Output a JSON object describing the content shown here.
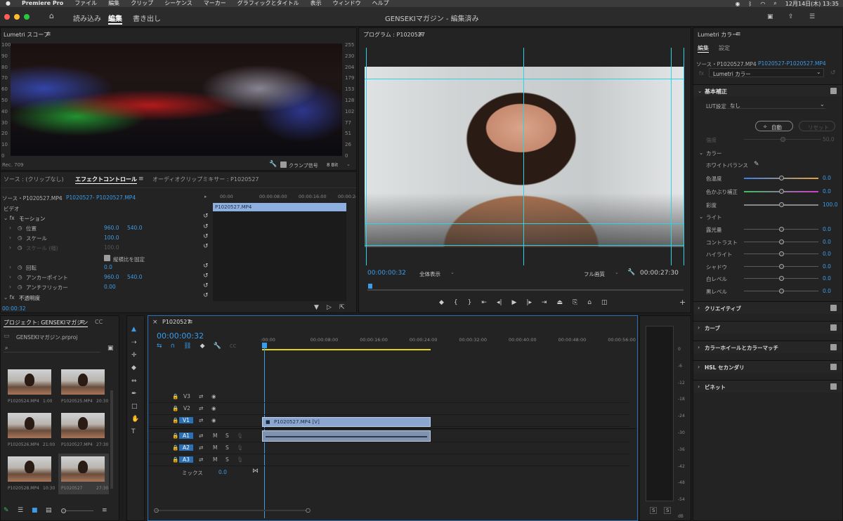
{
  "menubar": {
    "apple": "",
    "app": "Premiere Pro",
    "items": [
      "ファイル",
      "編集",
      "クリップ",
      "シーケンス",
      "マーカー",
      "グラフィックとタイトル",
      "表示",
      "ウィンドウ",
      "ヘルプ"
    ],
    "datetime": "12月14日(木) 13:35"
  },
  "titlebar": {
    "title": "GENSEKIマガジン - 編集済み",
    "tabs": [
      "読み込み",
      "編集",
      "書き出し"
    ]
  },
  "lumetri_scope": {
    "tab": "Lumetri スコープ",
    "left_ticks": [
      "100",
      "90",
      "80",
      "70",
      "60",
      "50",
      "40",
      "30",
      "20",
      "10",
      "0"
    ],
    "right_ticks": [
      "255",
      "230",
      "204",
      "179",
      "153",
      "128",
      "102",
      "77",
      "51",
      "26",
      "0"
    ],
    "footer_left": "Rec. 709",
    "clamp_label": "クランプ信号",
    "bit_depth": "8 Bit"
  },
  "effects": {
    "tabs": [
      "ソース : (クリップなし)",
      "エフェクトコントロール",
      "オーディオクリップミキサー : P1020527"
    ],
    "source_label": "ソース・P1020527.MP4",
    "sequence_label": "P1020527- P1020527.MP4",
    "time_ticks": [
      "00:00",
      "00:00:08:00",
      "00:00:16:00",
      "00:00:24:00"
    ],
    "clip_label": "P1020527.MP4",
    "video_label": "ビデオ",
    "motion": "モーション",
    "rows": [
      {
        "name": "位置",
        "v1": "960.0",
        "v2": "540.0"
      },
      {
        "name": "スケール",
        "v1": "100.0",
        "v2": ""
      },
      {
        "name": "スケール (幅)",
        "v1": "100.0",
        "v2": ""
      },
      {
        "name": "回転",
        "v1": "0.0",
        "v2": ""
      },
      {
        "name": "アンカーポイント",
        "v1": "960.0",
        "v2": "540.0"
      },
      {
        "name": "アンチフリッカー",
        "v1": "0.00",
        "v2": ""
      }
    ],
    "aspect_lock": "縦横比を固定",
    "opacity": "不透明度",
    "timecode": "00:00:32"
  },
  "program": {
    "tab": "プログラム : P1020527",
    "timecode_left": "00:00:00:32",
    "fit": "全体表示",
    "quality": "フル画質",
    "timecode_right": "00:00:27:30"
  },
  "lumetri_color": {
    "tab": "Lumetri カラー",
    "subtabs": [
      "編集",
      "設定"
    ],
    "source": "ソース・P1020527.MP4",
    "sequence": "P1020527-P1020527.MP4",
    "effect_name": "Lumetri カラー",
    "basic": "基本補正",
    "lut_label": "LUT設定",
    "lut_value": "なし",
    "auto": "自動",
    "reset": "リセット",
    "intensity": "強度",
    "intensity_val": "50.0",
    "color_group": "カラー",
    "white_balance": "ホワイトバランス",
    "light_group": "ライト",
    "sliders": [
      {
        "name": "色温度",
        "value": "0.0"
      },
      {
        "name": "色かぶり補正",
        "value": "0.0"
      },
      {
        "name": "彩度",
        "value": "100.0"
      }
    ],
    "light_sliders": [
      {
        "name": "露光量",
        "value": "0.0"
      },
      {
        "name": "コントラスト",
        "value": "0.0"
      },
      {
        "name": "ハイライト",
        "value": "0.0"
      },
      {
        "name": "シャドウ",
        "value": "0.0"
      },
      {
        "name": "白レベル",
        "value": "0.0"
      },
      {
        "name": "黒レベル",
        "value": "0.0"
      }
    ],
    "sections": [
      "クリエイティブ",
      "カーブ",
      "カラーホイールとカラーマッチ",
      "HSL セカンダリ",
      "ビネット"
    ]
  },
  "project": {
    "tabs": [
      "プロジェクト: GENSEKIマガジン",
      "CC"
    ],
    "file": "GENSEKIマガジン.prproj",
    "items": [
      {
        "name": "P1020524.MP4",
        "dur": "1:00"
      },
      {
        "name": "P1020525.MP4",
        "dur": "20:30"
      },
      {
        "name": "P1020526.MP4",
        "dur": "21:00"
      },
      {
        "name": "P1020527.MP4",
        "dur": "27:30"
      },
      {
        "name": "P1020528.MP4",
        "dur": "10:30"
      },
      {
        "name": "P1020527",
        "dur": "27:30"
      }
    ]
  },
  "timeline": {
    "tab": "P1020527",
    "timecode": "00:00:00:32",
    "ticks": [
      ":00:00",
      "00:00:08:00",
      "00:00:16:00",
      "00:00:24:00",
      "00:00:32:00",
      "00:00:40:00",
      "00:00:48:00",
      "00:00:56:00"
    ],
    "video_tracks": [
      "V3",
      "V2",
      "V1"
    ],
    "audio_tracks": [
      "A1",
      "A2",
      "A3"
    ],
    "mix": "ミックス",
    "mix_val": "0.0",
    "clip_v": "P1020527.MP4 [V]"
  },
  "meter": {
    "ticks": [
      "0",
      "-6",
      "-12",
      "-18",
      "-24",
      "-30",
      "-36",
      "-42",
      "-48",
      "-54",
      "dB"
    ],
    "solo": [
      "S",
      "S"
    ]
  }
}
